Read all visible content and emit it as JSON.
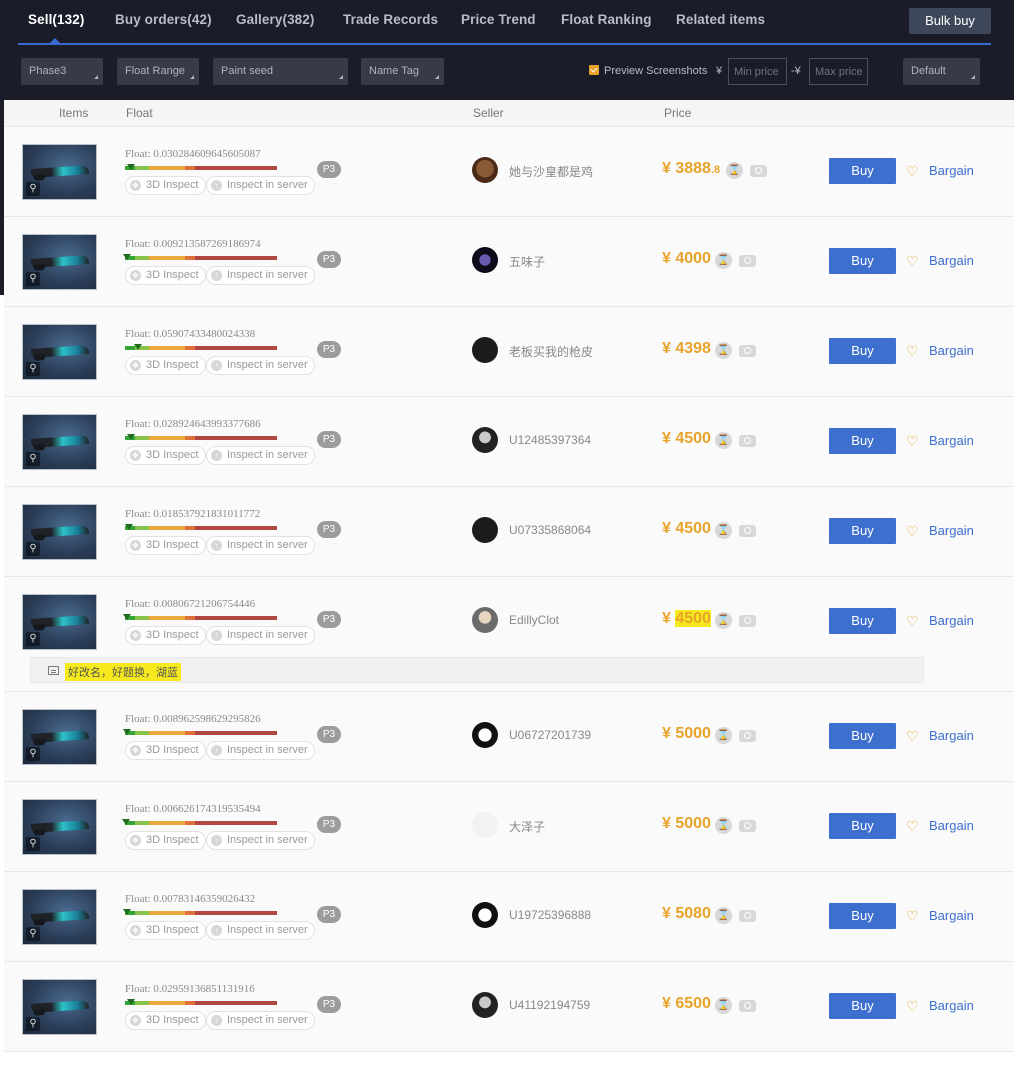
{
  "tabs": [
    {
      "label": "Sell(132)",
      "active": true
    },
    {
      "label": "Buy orders(42)",
      "active": false
    },
    {
      "label": "Gallery(382)",
      "active": false
    },
    {
      "label": "Trade Records",
      "active": false
    },
    {
      "label": "Price Trend",
      "active": false
    },
    {
      "label": "Float Ranking",
      "active": false
    },
    {
      "label": "Related items",
      "active": false
    }
  ],
  "bulk_buy_label": "Bulk buy",
  "filters": {
    "phase": "Phase3",
    "float_range": "Float Range",
    "paint_seed": "Paint seed",
    "name_tag": "Name Tag",
    "preview_label": "Preview Screenshots",
    "preview_checked": true,
    "currency_symbol": "¥",
    "range_sep": "-¥",
    "min_placeholder": "Min price",
    "max_placeholder": "Max price",
    "sort": "Default"
  },
  "columns": {
    "items": "Items",
    "float": "Float",
    "seller": "Seller",
    "price": "Price"
  },
  "common": {
    "inspect3d": "3D Inspect",
    "inspect_server": "Inspect in server",
    "buy": "Buy",
    "bargain": "Bargain",
    "currency": "¥"
  },
  "colors": {
    "accent": "#3d6fcf",
    "price": "#e8a32a",
    "header_bg": "#1a1d29",
    "highlight": "#f6ea1e"
  },
  "listings": [
    {
      "float": "Float: 0.030284609645605087",
      "float_value": 0.030284609645605087,
      "phase": "P3",
      "seller": "她与沙皇都是鸡",
      "price_main": "3888",
      "price_frac": ".8",
      "avatar": "dog-avatar"
    },
    {
      "float": "Float: 0.009213587269186974",
      "float_value": 0.009213587269186974,
      "phase": "P3",
      "seller": "五味子",
      "price_main": "4000",
      "price_frac": "",
      "avatar": "planet-avatar"
    },
    {
      "float": "Float: 0.05907433480024338",
      "float_value": 0.05907433480024338,
      "phase": "P3",
      "seller": "老板买我的枪皮",
      "price_main": "4398",
      "price_frac": "",
      "avatar": "question-avatar"
    },
    {
      "float": "Float: 0.028924643993377686",
      "float_value": 0.028924643993377686,
      "phase": "P3",
      "seller": "U12485397364",
      "price_main": "4500",
      "price_frac": "",
      "avatar": "person-avatar"
    },
    {
      "float": "Float: 0.018537921831011772",
      "float_value": 0.018537921831011772,
      "phase": "P3",
      "seller": "U07335868064",
      "price_main": "4500",
      "price_frac": "",
      "avatar": "question-avatar"
    },
    {
      "float": "Float: 0.00806721206754446",
      "float_value": 0.00806721206754446,
      "phase": "P3",
      "seller": "EdillyClot",
      "price_main": "4500",
      "price_frac": "",
      "avatar": "portrait-avatar",
      "highlight": true,
      "note": "好改名，好题换，湖蓝"
    },
    {
      "float": "Float: 0.008962598629295826",
      "float_value": 0.008962598629295826,
      "phase": "P3",
      "seller": "U06727201739",
      "price_main": "5000",
      "price_frac": "",
      "avatar": "anime-avatar"
    },
    {
      "float": "Float: 0.006626174319535494",
      "float_value": 0.006626174319535494,
      "phase": "P3",
      "seller": "大泽子",
      "price_main": "5000",
      "price_frac": "",
      "avatar": "text-logo-avatar"
    },
    {
      "float": "Float: 0.00783146359026432",
      "float_value": 0.00783146359026432,
      "phase": "P3",
      "seller": "U19725396888",
      "price_main": "5080",
      "price_frac": "",
      "avatar": "anime-avatar"
    },
    {
      "float": "Float: 0.02959136851131916",
      "float_value": 0.02959136851131916,
      "phase": "P3",
      "seller": "U41192194759",
      "price_main": "6500",
      "price_frac": "",
      "avatar": "person-avatar"
    }
  ]
}
